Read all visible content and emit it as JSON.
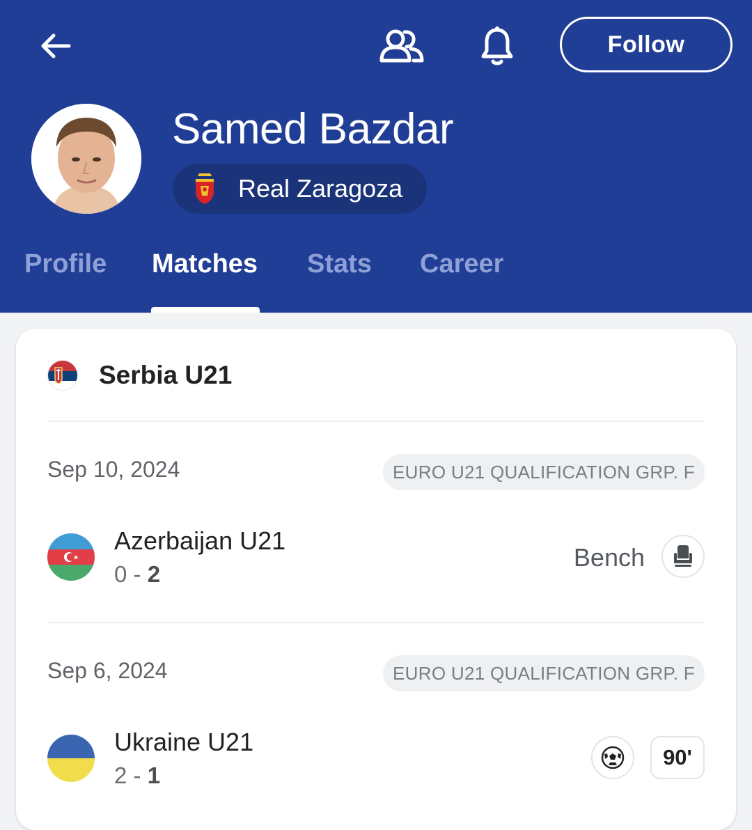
{
  "header": {
    "follow_label": "Follow",
    "player_name": "Samed Bazdar",
    "team_name": "Real Zaragoza",
    "colors": {
      "header_bg": "#213e96",
      "pill_bg": "#1b3479"
    },
    "icons": {
      "back": "arrow-left-icon",
      "squad": "people-icon",
      "notify": "bell-icon"
    }
  },
  "tabs": [
    {
      "label": "Profile",
      "active": false
    },
    {
      "label": "Matches",
      "active": true
    },
    {
      "label": "Stats",
      "active": false
    },
    {
      "label": "Career",
      "active": false
    }
  ],
  "card": {
    "team": "Serbia U21",
    "matches": [
      {
        "date": "Sep 10, 2024",
        "competition": "EURO U21 QUALIFICATION GRP. F",
        "opponent": "Azerbaijan U21",
        "score_left": "0",
        "score_sep": " - ",
        "score_right": "2",
        "status": "Bench",
        "status_icon": "bench-seat-icon"
      },
      {
        "date": "Sep 6, 2024",
        "competition": "EURO U21 QUALIFICATION GRP. F",
        "opponent": "Ukraine U21",
        "score_left": "2",
        "score_sep": " - ",
        "score_right": "1",
        "event_icon": "soccer-ball-icon",
        "minutes": "90'"
      }
    ]
  }
}
